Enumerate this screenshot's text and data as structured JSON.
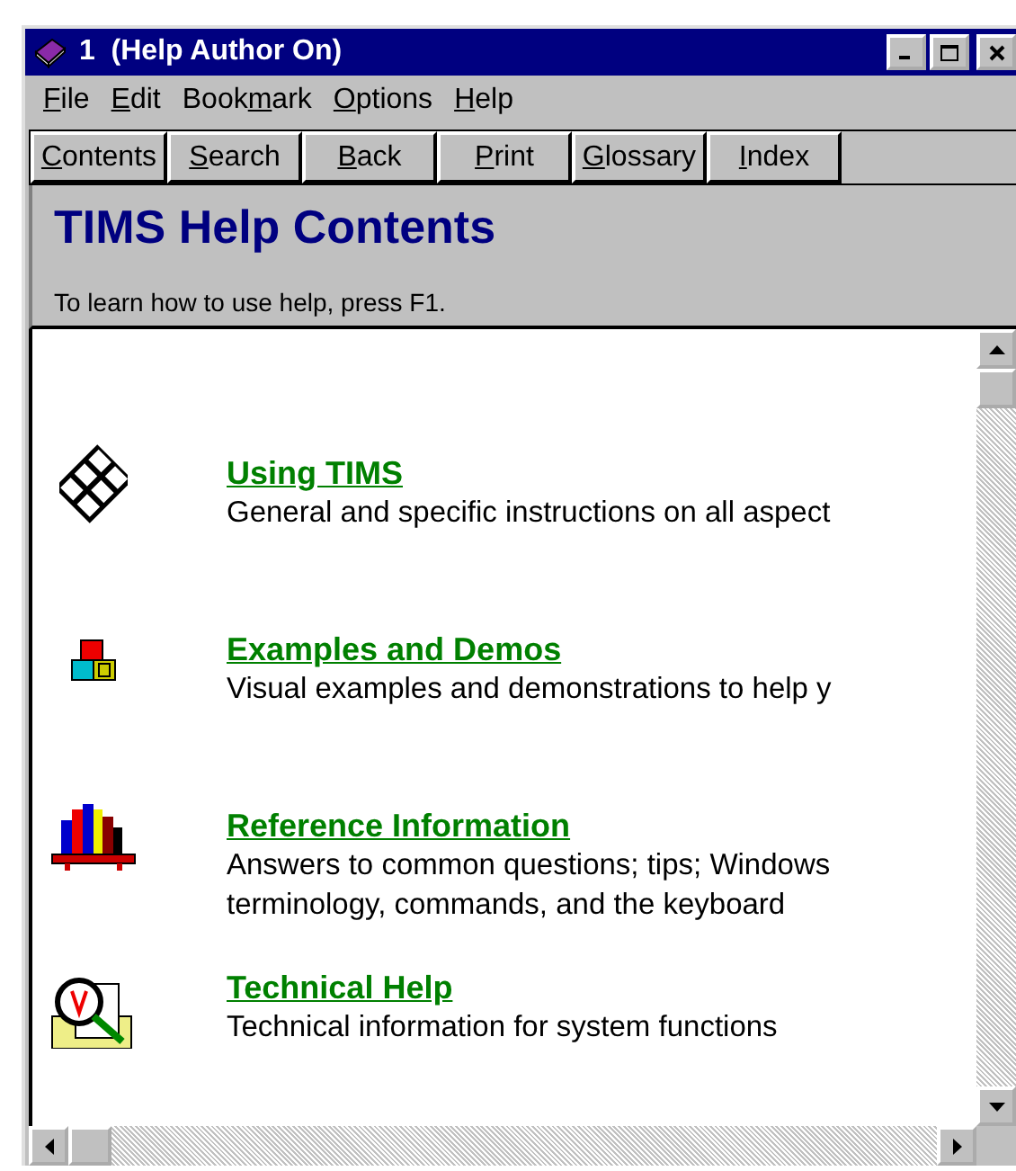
{
  "window": {
    "title": "1  (Help Author On)"
  },
  "menu": [
    {
      "label": "File"
    },
    {
      "label": "Edit"
    },
    {
      "label": "Bookmark"
    },
    {
      "label": "Options"
    },
    {
      "label": "Help"
    }
  ],
  "toolbar": [
    {
      "label": "Contents"
    },
    {
      "label": "Search"
    },
    {
      "label": "Back"
    },
    {
      "label": "Print"
    },
    {
      "label": "Glossary"
    },
    {
      "label": "Index"
    }
  ],
  "header": {
    "title": "TIMS Help Contents",
    "hint": "To learn how to use help, press F1."
  },
  "topics": [
    {
      "kind": "keyboard",
      "link": "Using TIMS",
      "description": "General and specific instructions on all aspect"
    },
    {
      "kind": "blocks",
      "link": "Examples and Demos",
      "description": "Visual examples and demonstrations to help y"
    },
    {
      "kind": "books",
      "link": "Reference Information",
      "description": "Answers to common questions; tips; Windows terminology, commands, and the keyboard"
    },
    {
      "kind": "magnifier",
      "link": "Technical Help",
      "description": "Technical information for system functions"
    }
  ]
}
